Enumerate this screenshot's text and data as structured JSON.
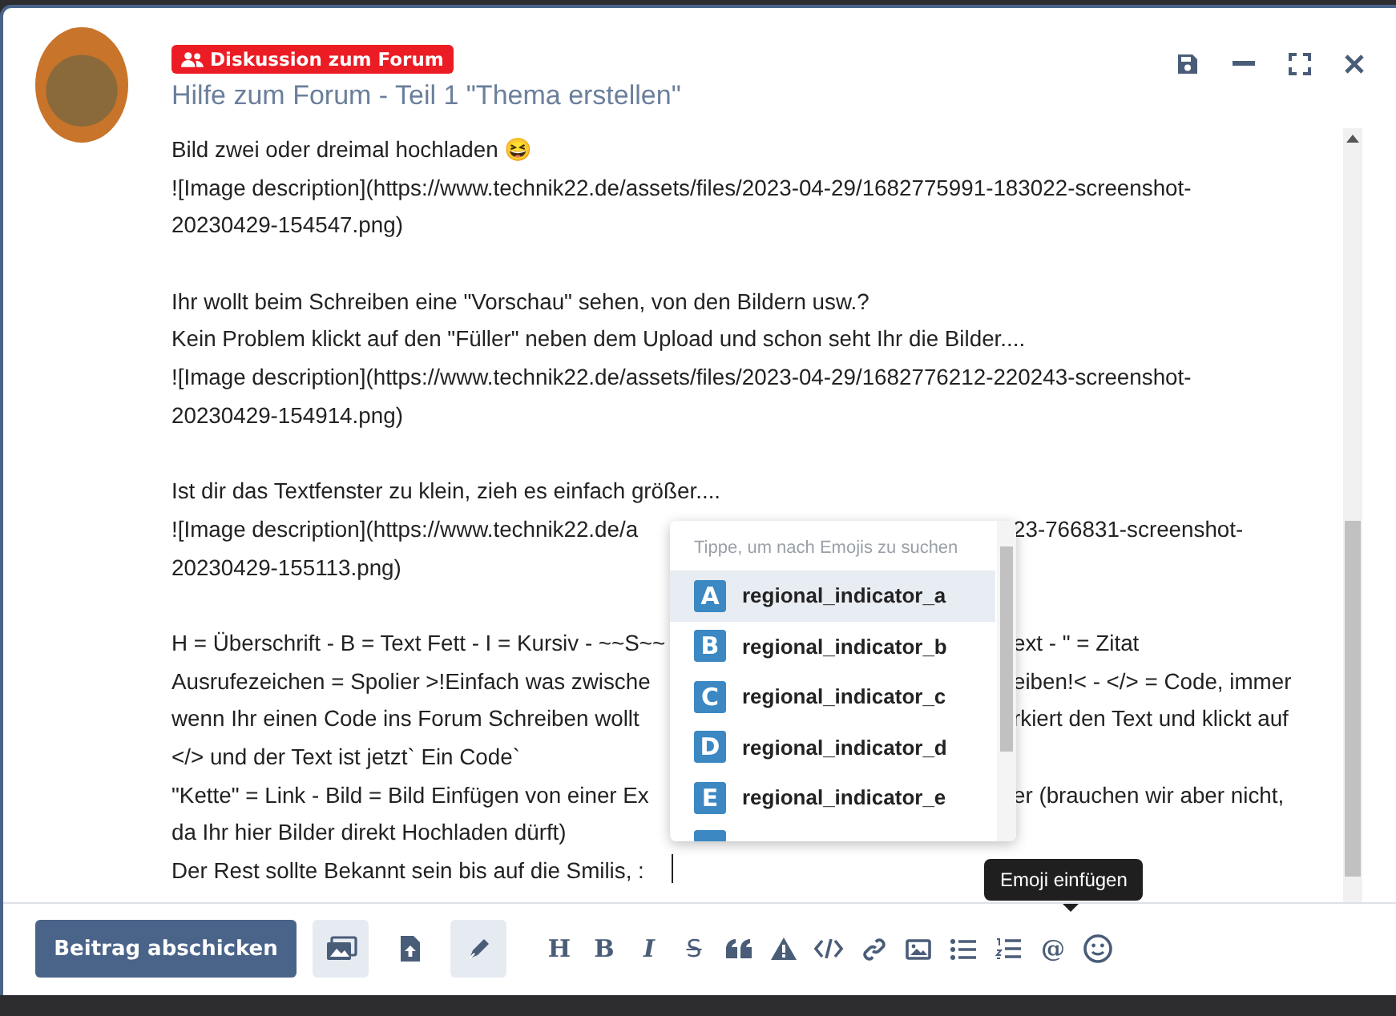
{
  "header": {
    "badge": "Diskussion zum Forum",
    "title": "Hilfe zum Forum - Teil 1 \"Thema erstellen\""
  },
  "editor": {
    "paragraphs": [
      {
        "lines": [
          {
            "text": "Bild zwei oder dreimal hochladen 😆"
          },
          {
            "text": "![Image description](https://www.technik22.de/assets/files/2023-04-29/1682775991-183022-screenshot-"
          },
          {
            "text": "20230429-154547.png)"
          }
        ]
      },
      {
        "lines": [
          {
            "text": "Ihr wollt beim Schreiben eine \"Vorschau\" sehen, von den Bildern usw.?"
          },
          {
            "text": "Kein Problem klickt auf den \"Füller\" neben dem Upload und schon seht Ihr die Bilder...."
          },
          {
            "text": "![Image description](https://www.technik22.de/assets/files/2023-04-29/1682776212-220243-screenshot-"
          },
          {
            "text": "20230429-154914.png)"
          }
        ]
      },
      {
        "lines": [
          {
            "text": "Ist dir das Textfenster zu klein, zieh es einfach größer...."
          },
          {
            "text": "![Image description](https://www.technik22.de/a",
            "after": "23-766831-screenshot-"
          },
          {
            "text": "20230429-155113.png)"
          }
        ]
      },
      {
        "lines": [
          {
            "text": "H = Überschrift - B = Text Fett - I = Kursiv - ~~S~~",
            "after": "ext - \" = Zitat"
          },
          {
            "text": "Ausrufezeichen = Spolier  >!Einfach was zwische",
            "after": "eiben!< - </> = Code, immer"
          },
          {
            "text": "wenn Ihr einen Code ins Forum Schreiben wollt",
            "after": "rkiert den Text und klickt auf"
          },
          {
            "text": "</> und der Text ist jetzt` Ein Code`"
          },
          {
            "text": "\"Kette\" = Link - Bild = Bild Einfügen von einer Ex",
            "after": "er (brauchen wir aber nicht,"
          },
          {
            "text": "da Ihr hier Bilder direkt Hochladen dürft)"
          },
          {
            "text": "Der Rest sollte Bekannt sein bis auf die Smilis,  :"
          }
        ]
      }
    ]
  },
  "emoji_popup": {
    "placeholder": "Tippe, um nach Emojis zu suchen",
    "items": [
      {
        "letter": "A",
        "name": "regional_indicator_a",
        "selected": true
      },
      {
        "letter": "B",
        "name": "regional_indicator_b",
        "selected": false
      },
      {
        "letter": "C",
        "name": "regional_indicator_c",
        "selected": false
      },
      {
        "letter": "D",
        "name": "regional_indicator_d",
        "selected": false
      },
      {
        "letter": "E",
        "name": "regional_indicator_e",
        "selected": false
      }
    ]
  },
  "tooltip": "Emoji einfügen",
  "toolbar": {
    "submit": "Beitrag abschicken",
    "modes": [
      {
        "selected": true
      },
      {
        "selected": false
      },
      {
        "selected": true
      }
    ],
    "format": [
      {
        "kind": "text",
        "label": "H"
      },
      {
        "kind": "text",
        "label": "B"
      },
      {
        "kind": "italic",
        "label": "I"
      },
      {
        "kind": "strike",
        "label": "S"
      },
      {
        "kind": "icon"
      },
      {
        "kind": "icon"
      },
      {
        "kind": "icon"
      },
      {
        "kind": "icon"
      },
      {
        "kind": "icon"
      },
      {
        "kind": "icon"
      },
      {
        "kind": "icon"
      },
      {
        "kind": "text",
        "label": "@"
      },
      {
        "kind": "icon"
      }
    ]
  }
}
